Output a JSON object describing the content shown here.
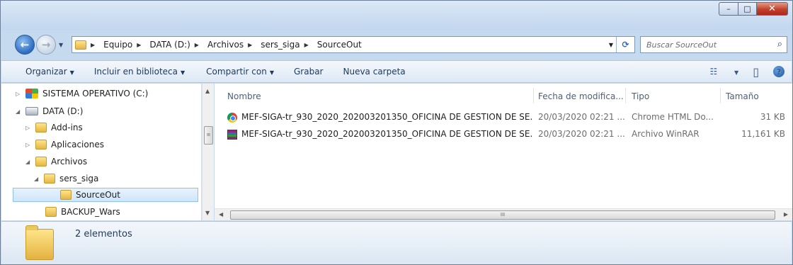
{
  "window": {
    "caption": {
      "minimize": "–",
      "maximize": "□",
      "close": "✕"
    }
  },
  "nav": {
    "back_icon": "←",
    "forward_icon": "→",
    "dropdown_icon": "▼"
  },
  "address": {
    "breadcrumbs": [
      "Equipo",
      "DATA (D:)",
      "Archivos",
      "sers_siga",
      "SourceOut"
    ],
    "separator": "▶",
    "dropdown_icon": "▼",
    "refresh_icon": "⟳"
  },
  "search": {
    "placeholder": "Buscar SourceOut",
    "icon": "⌕"
  },
  "toolbar": {
    "organizar": "Organizar",
    "incluir": "Incluir en biblioteca",
    "compartir": "Compartir con",
    "grabar": "Grabar",
    "nueva_carpeta": "Nueva carpeta",
    "arrow": "▼",
    "view_icon": "☷",
    "view_arrow": "▼",
    "pane_icon": "▯",
    "help_icon": "?"
  },
  "tree": {
    "items": [
      {
        "label": "SISTEMA OPERATIVO (C:)",
        "icon": "windows-drive-icon",
        "expander": "▷"
      },
      {
        "label": "DATA (D:)",
        "icon": "drive-icon",
        "expander": "◢"
      },
      {
        "label": "Add-ins",
        "icon": "folder-icon",
        "expander": "▷"
      },
      {
        "label": "Aplicaciones",
        "icon": "folder-icon",
        "expander": "▷"
      },
      {
        "label": "Archivos",
        "icon": "folder-icon",
        "expander": "◢"
      },
      {
        "label": "sers_siga",
        "icon": "folder-icon",
        "expander": "◢"
      },
      {
        "label": "SourceOut",
        "icon": "folder-icon",
        "expander": "",
        "selected": true
      },
      {
        "label": "BACKUP_Wars",
        "icon": "folder-icon",
        "expander": ""
      }
    ]
  },
  "scroll": {
    "up": "▲",
    "down": "▼",
    "left": "◀",
    "right": "▶",
    "grip": "≡",
    "hgrip": "III"
  },
  "columns": {
    "name": "Nombre",
    "date": "Fecha de modifica...",
    "type": "Tipo",
    "size": "Tamaño",
    "sort_indicator": "ˇ"
  },
  "files": [
    {
      "name": "MEF-SIGA-tr_930_2020_202003201350_OFICINA DE GESTION DE SE...",
      "date": "20/03/2020 02:21 ...",
      "type": "Chrome HTML Do...",
      "size": "31 KB",
      "icon": "chrome-icon"
    },
    {
      "name": "MEF-SIGA-tr_930_2020_202003201350_OFICINA DE GESTION DE SE...",
      "date": "20/03/2020 02:21 ...",
      "type": "Archivo WinRAR",
      "size": "11,161 KB",
      "icon": "winrar-icon"
    }
  ],
  "details": {
    "count": "2 elementos"
  }
}
